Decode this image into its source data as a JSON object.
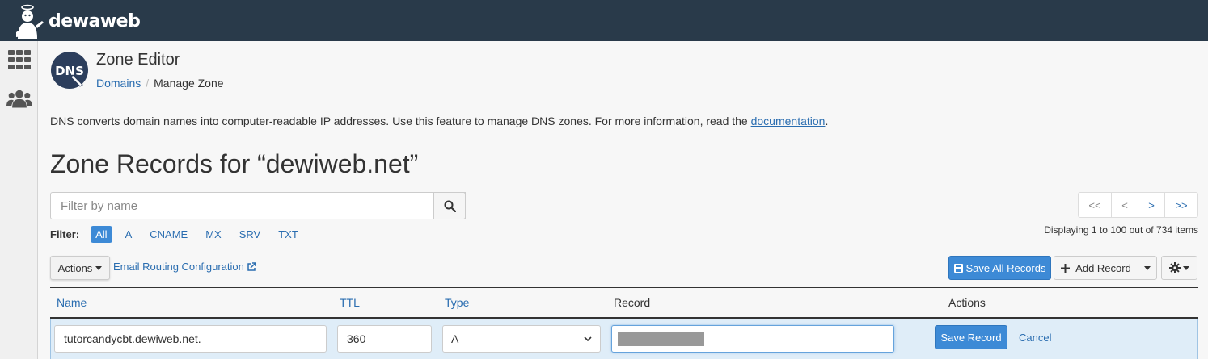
{
  "brand": {
    "name": "dewaweb"
  },
  "header": {
    "title": "Zone Editor",
    "breadcrumb": {
      "parent": "Domains",
      "current": "Manage Zone"
    },
    "dns_logo_text": "DNS"
  },
  "intro": {
    "text": "DNS converts domain names into computer-readable IP addresses. Use this feature to manage DNS zones. For more information, read the ",
    "link": "documentation",
    "suffix": "."
  },
  "zone_heading": "Zone Records for “dewiweb.net”",
  "search": {
    "placeholder": "Filter by name"
  },
  "filter": {
    "label": "Filter:",
    "options": [
      "All",
      "A",
      "CNAME",
      "MX",
      "SRV",
      "TXT"
    ],
    "active": "All"
  },
  "pager": {
    "first": "<<",
    "prev": "<",
    "next": ">",
    "last": ">>"
  },
  "displaying": "Displaying 1 to 100 out of 734 items",
  "toolbar": {
    "actions": "Actions",
    "email_routing": "Email Routing Configuration",
    "save_all": "Save All Records",
    "add_record": "Add Record"
  },
  "table": {
    "headers": {
      "name": "Name",
      "ttl": "TTL",
      "type": "Type",
      "record": "Record",
      "actions": "Actions"
    },
    "edit_row": {
      "name": "tutorcandycbt.dewiweb.net.",
      "ttl": "360",
      "type": "A",
      "save": "Save Record",
      "cancel": "Cancel"
    }
  },
  "colors": {
    "topbar": "#293a4a",
    "accent": "#3d8ad6",
    "link": "#2a6db0",
    "edit_row_bg": "#dfedf8"
  }
}
